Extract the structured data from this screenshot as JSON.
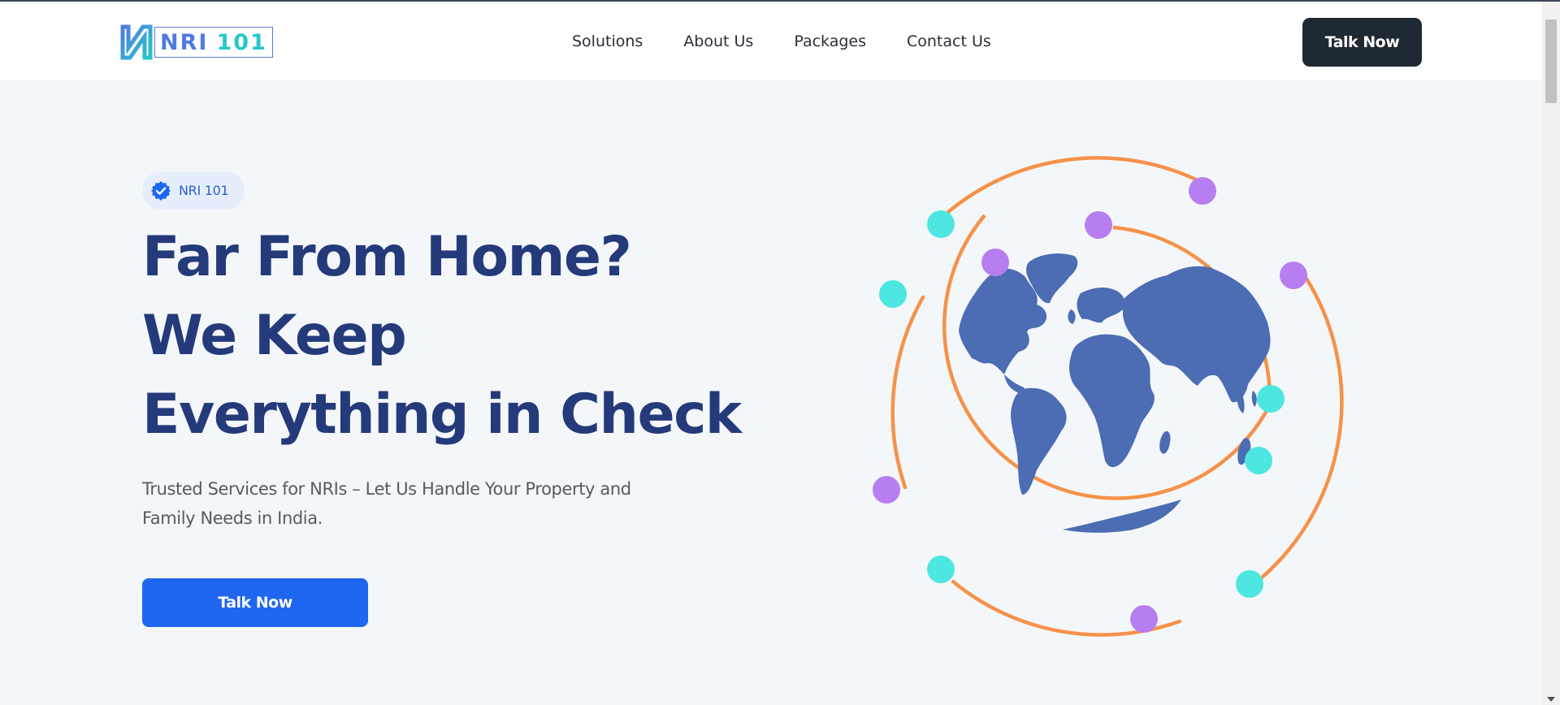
{
  "header": {
    "logo": {
      "brand": "NRI",
      "number": "101",
      "icon": "n-logo-icon"
    },
    "nav": [
      {
        "label": "Solutions"
      },
      {
        "label": "About Us"
      },
      {
        "label": "Packages"
      },
      {
        "label": "Contact Us"
      }
    ],
    "cta_label": "Talk Now"
  },
  "hero": {
    "badge": {
      "icon": "verified-check-icon",
      "label": "NRI 101"
    },
    "headline": [
      "Far From Home?",
      "We Keep",
      "Everything in Check"
    ],
    "subtext": "Trusted Services for NRIs – Let Us Handle Your Property and Family Needs in India.",
    "cta_label": "Talk Now",
    "illustration": "globe-orbit-illustration"
  },
  "colors": {
    "headline": "#253a7a",
    "primary_button": "#1f66f0",
    "dark_button": "#1f2933",
    "orbit": "#f5924a",
    "dot_teal": "#4de6e0",
    "dot_purple": "#b67ef0",
    "globe": "#4c6cb3",
    "page_bg": "#f4f7fa"
  }
}
